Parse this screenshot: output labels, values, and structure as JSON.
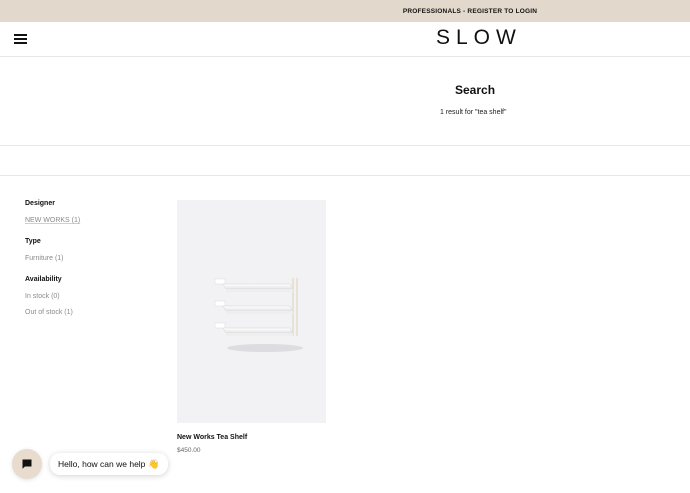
{
  "promo": {
    "text": "PROFESSIONALS - REGISTER TO LOGIN"
  },
  "header": {
    "logo": "SLOW",
    "menu_icon": "hamburger-menu-icon"
  },
  "search": {
    "title": "Search",
    "count_text": "1 result for \"tea shelf\""
  },
  "filters": [
    {
      "title": "Designer",
      "options": [
        "NEW WORKS (1)"
      ]
    },
    {
      "title": "Type",
      "options": [
        "Furniture (1)"
      ]
    },
    {
      "title": "Availability",
      "options": [
        "In stock (0)",
        "Out of stock (1)"
      ]
    }
  ],
  "product": {
    "name": "New Works Tea Shelf",
    "price": "$450.00",
    "image_icon": "wall-shelf-image"
  },
  "chat": {
    "button_icon": "chat-icon",
    "greeting": "Hello, how can we help",
    "emoji": "👋"
  },
  "colors": {
    "promo_bg": "#e2d9cc",
    "image_bg": "#f2f2f5",
    "chat_bg": "#e7dccd"
  }
}
